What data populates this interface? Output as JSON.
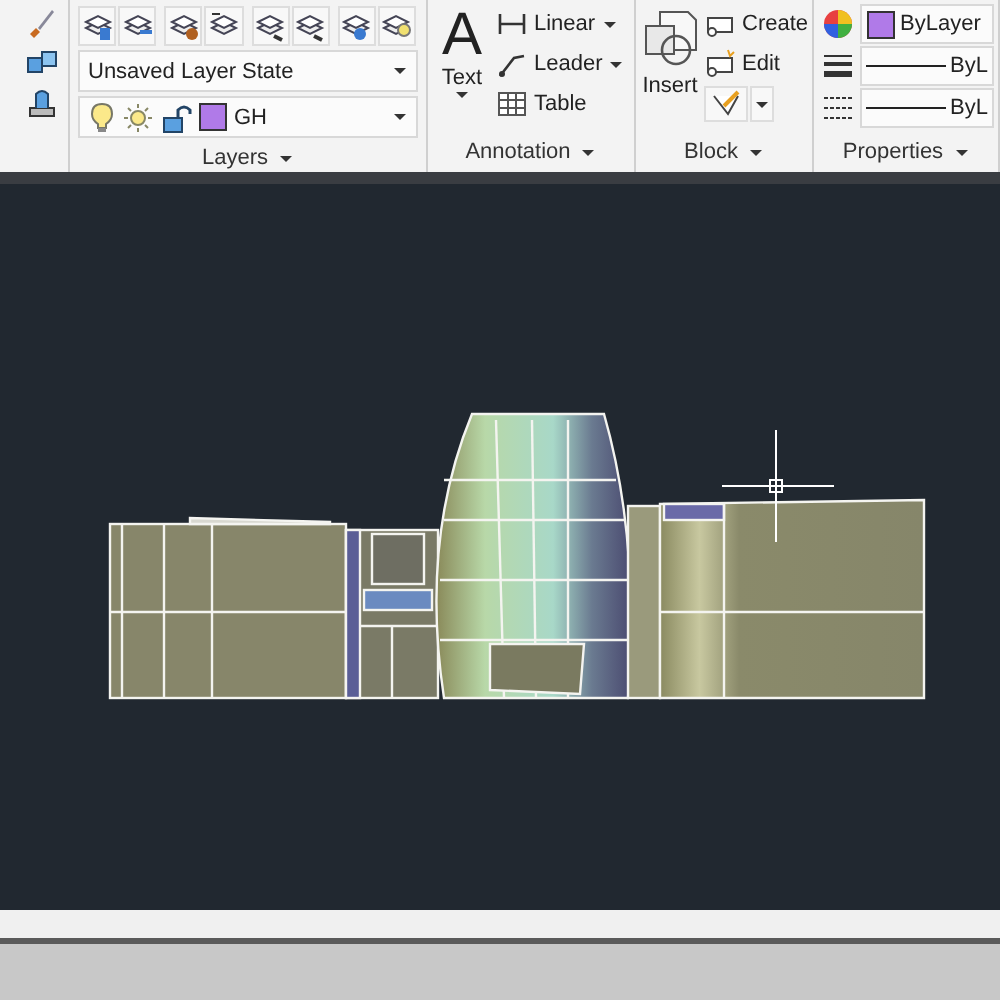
{
  "ribbon": {
    "panels": [
      {
        "kind": "tools"
      },
      {
        "kind": "layers",
        "title": "Layers",
        "layer_state": "Unsaved Layer State",
        "current_layer": "GH"
      },
      {
        "kind": "annotation",
        "title": "Annotation",
        "glyph": "A",
        "text_tool": "Text",
        "tools": [
          {
            "label": "Linear",
            "dropdown": true
          },
          {
            "label": "Leader",
            "dropdown": true
          },
          {
            "label": "Table",
            "dropdown": false
          }
        ]
      },
      {
        "kind": "block",
        "title": "Block",
        "insert": "Insert",
        "tools": [
          "Create",
          "Edit"
        ]
      },
      {
        "kind": "properties",
        "title": "Properties",
        "color_value": "ByLayer",
        "lineweight": "ByL",
        "linetype": "ByL"
      }
    ]
  }
}
